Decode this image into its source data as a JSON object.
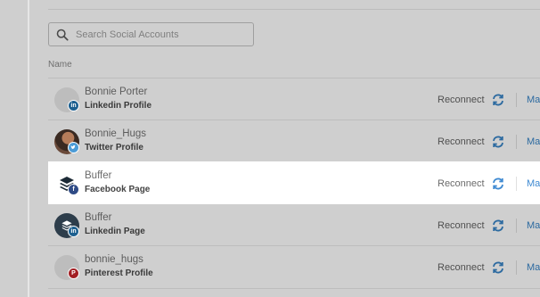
{
  "search": {
    "placeholder": "Search Social Accounts"
  },
  "table": {
    "column_name": "Name"
  },
  "accounts": [
    {
      "name": "Bonnie Porter",
      "type": "Linkedin Profile",
      "network": "linkedin",
      "reconnect": "Reconnect",
      "manage": "Ma"
    },
    {
      "name": "Bonnie_Hugs",
      "type": "Twitter Profile",
      "network": "twitter",
      "reconnect": "Reconnect",
      "manage": "Ma"
    },
    {
      "name": "Buffer",
      "type": "Facebook Page",
      "network": "facebook",
      "reconnect": "Reconnect",
      "manage": "Ma"
    },
    {
      "name": "Buffer",
      "type": "Linkedin Page",
      "network": "linkedin",
      "reconnect": "Reconnect",
      "manage": "Ma"
    },
    {
      "name": "bonnie_hugs",
      "type": "Pinterest Profile",
      "network": "pinterest",
      "reconnect": "Reconnect",
      "manage": "Ma"
    }
  ],
  "colors": {
    "accent": "#3f8ad2",
    "overlay": "#cfcfcf",
    "highlight_row": "#ffffff"
  },
  "icons": {
    "search": "search-icon",
    "sync": "sync-icon"
  }
}
